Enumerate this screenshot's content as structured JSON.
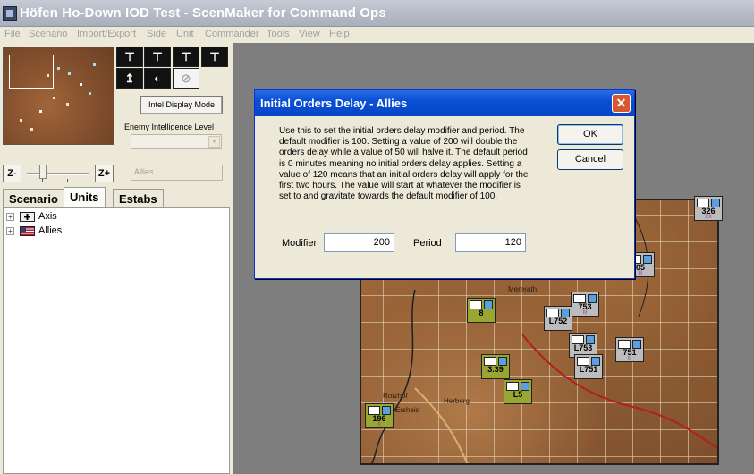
{
  "window": {
    "title": "Höfen Ho-Down IOD Test - ScenMaker for Command Ops"
  },
  "menu": [
    "File",
    "Scenario",
    "Import/Export",
    "Side",
    "Unit",
    "Commander",
    "Tools",
    "View",
    "Help"
  ],
  "left_panel": {
    "intel_button": "Intel Display Mode",
    "intel_level_label": "Enemy Intelligence Level",
    "intel_level_value": "",
    "side_field": "Allies",
    "zoom_out": "Z-",
    "zoom_in": "Z+",
    "tabs": [
      "Scenario",
      "Units",
      "Estabs"
    ],
    "active_tab": "Units",
    "tree": [
      {
        "label": "Axis",
        "expander": "+"
      },
      {
        "label": "Allies",
        "expander": "+"
      }
    ]
  },
  "dialog": {
    "title": "Initial Orders Delay - Allies",
    "close_glyph": "✕",
    "description": "Use this to set the initial orders delay modifier and period. The default modifier is 100. Setting a value of 200 will double the orders delay while a value of 50 will halve it. The default period is 0 minutes meaning no initial orders delay applies. Setting a value of 120 means that an initial orders delay will apply for the first two hours. The value will start at whatever the modifier is set to and gravitate towards the default modifier of 100.",
    "ok_label": "OK",
    "cancel_label": "Cancel",
    "modifier_label": "Modifier",
    "modifier_value": "200",
    "period_label": "Period",
    "period_value": "120"
  },
  "map": {
    "place_labels": [
      "Mererath",
      "Rotzhof",
      "Ersheid",
      "Herberg"
    ],
    "units": [
      {
        "id": "326",
        "size": "XX",
        "color": "grey"
      },
      {
        "id": "05",
        "size": "III",
        "color": "grey"
      },
      {
        "id": "753",
        "size": "III",
        "color": "grey"
      },
      {
        "id": "L752",
        "size": "",
        "color": "grey"
      },
      {
        "id": "L753",
        "size": "",
        "color": "grey"
      },
      {
        "id": "751",
        "size": "III",
        "color": "grey"
      },
      {
        "id": "L751",
        "size": "",
        "color": "grey"
      },
      {
        "id": "8",
        "size": "",
        "color": "green"
      },
      {
        "id": "3.39",
        "size": "",
        "color": "green"
      },
      {
        "id": "196",
        "size": "II",
        "color": "green"
      },
      {
        "id": "L5",
        "size": "",
        "color": "green"
      }
    ]
  }
}
